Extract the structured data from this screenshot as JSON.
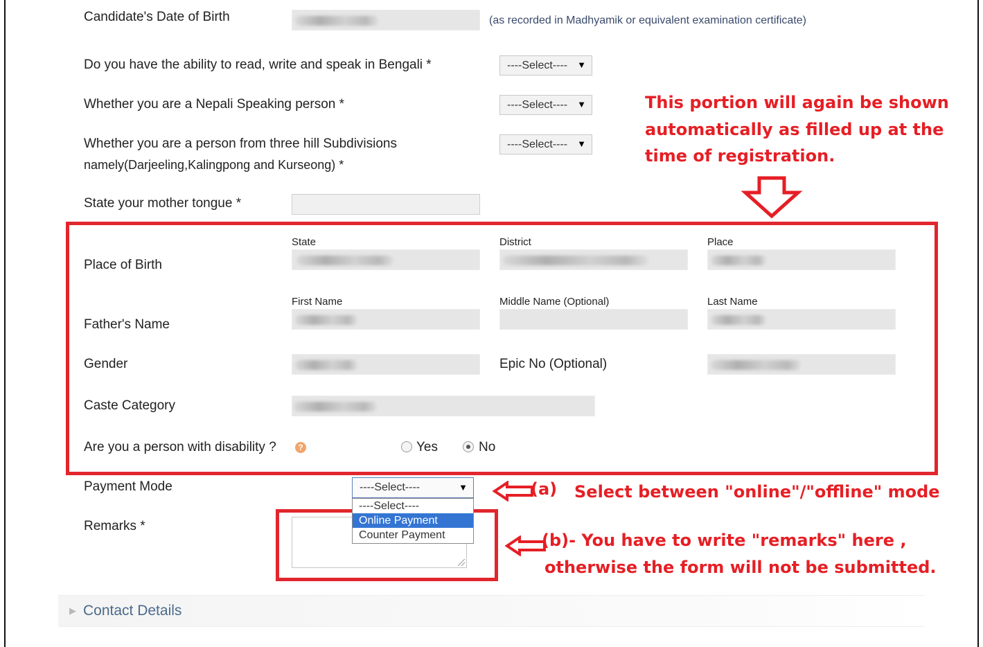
{
  "form": {
    "dob": {
      "label": "Candidate's Date of Birth",
      "note": "(as recorded in Madhyamik or equivalent examination certificate)"
    },
    "bengali": {
      "label": "Do you have the ability to read, write and speak in Bengali *",
      "value": "----Select----"
    },
    "nepali": {
      "label": "Whether you are a Nepali Speaking person *",
      "value": "----Select----"
    },
    "hill": {
      "label_line1": "Whether you are a person from three hill Subdivisions",
      "label_line2": "namely(Darjeeling,Kalingpong and Kurseong) *",
      "value": "----Select----"
    },
    "mother_tongue": {
      "label": "State your mother tongue *",
      "value": ""
    },
    "place_of_birth": {
      "label": "Place of Birth",
      "state_label": "State",
      "district_label": "District",
      "place_label": "Place"
    },
    "father_name": {
      "label": "Father's Name",
      "first_label": "First Name",
      "middle_label": "Middle Name (Optional)",
      "last_label": "Last Name"
    },
    "gender": {
      "label": "Gender"
    },
    "epic": {
      "label": "Epic No (Optional)"
    },
    "caste": {
      "label": "Caste Category"
    },
    "disability": {
      "label": "Are you a person with disability ?",
      "help_icon": "?",
      "options": [
        "Yes",
        "No"
      ],
      "selected": "No"
    },
    "payment": {
      "label": "Payment Mode",
      "value": "----Select----",
      "options": [
        "----Select----",
        "Online Payment",
        "Counter Payment"
      ],
      "highlighted": "Online Payment"
    },
    "remarks": {
      "label": "Remarks *",
      "value": ""
    }
  },
  "section": {
    "contact_details": "Contact Details",
    "icon": "chevron-right-icon"
  },
  "annotations": {
    "portion_line1": "This portion will again be shown",
    "portion_line2": "automatically as filled up at the",
    "portion_line3": "time of registration.",
    "a_label": "(a)",
    "a_text": "Select between \"online\"/\"offline\" mode",
    "b_label": "(b)- You have to write \"remarks\" here ,",
    "b_text": "otherwise the form will not be submitted."
  },
  "colors": {
    "annotation_red": "#e51f25",
    "highlight_blue": "#3475d4",
    "field_gray": "#e6e6e6"
  }
}
